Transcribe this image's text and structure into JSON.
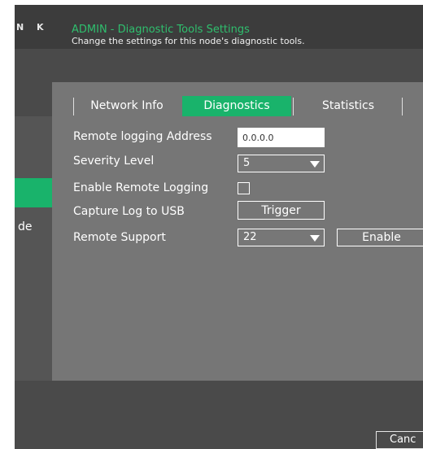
{
  "brand": "N K",
  "header": {
    "title": "ADMIN - Diagnostic Tools Settings",
    "subtitle": "Change the settings for this node's diagnostic tools."
  },
  "sidebar": {
    "partial_label": "de"
  },
  "tabs": [
    {
      "label": "Network Info",
      "active": false
    },
    {
      "label": "Diagnostics",
      "active": true
    },
    {
      "label": "Statistics",
      "active": false
    }
  ],
  "form": {
    "remote_logging_address": {
      "label": "Remote logging Address",
      "value": "0.0.0.0"
    },
    "severity_level": {
      "label": "Severity Level",
      "value": "5"
    },
    "enable_remote_logging": {
      "label": "Enable Remote Logging",
      "checked": false
    },
    "capture_log": {
      "label": "Capture Log to USB",
      "button": "Trigger"
    },
    "remote_support": {
      "label": "Remote Support",
      "value": "22",
      "button": "Enable"
    }
  },
  "footer": {
    "cancel": "Canc"
  },
  "colors": {
    "accent": "#19b36b",
    "title": "#2fbf6e",
    "panel": "#767676"
  }
}
